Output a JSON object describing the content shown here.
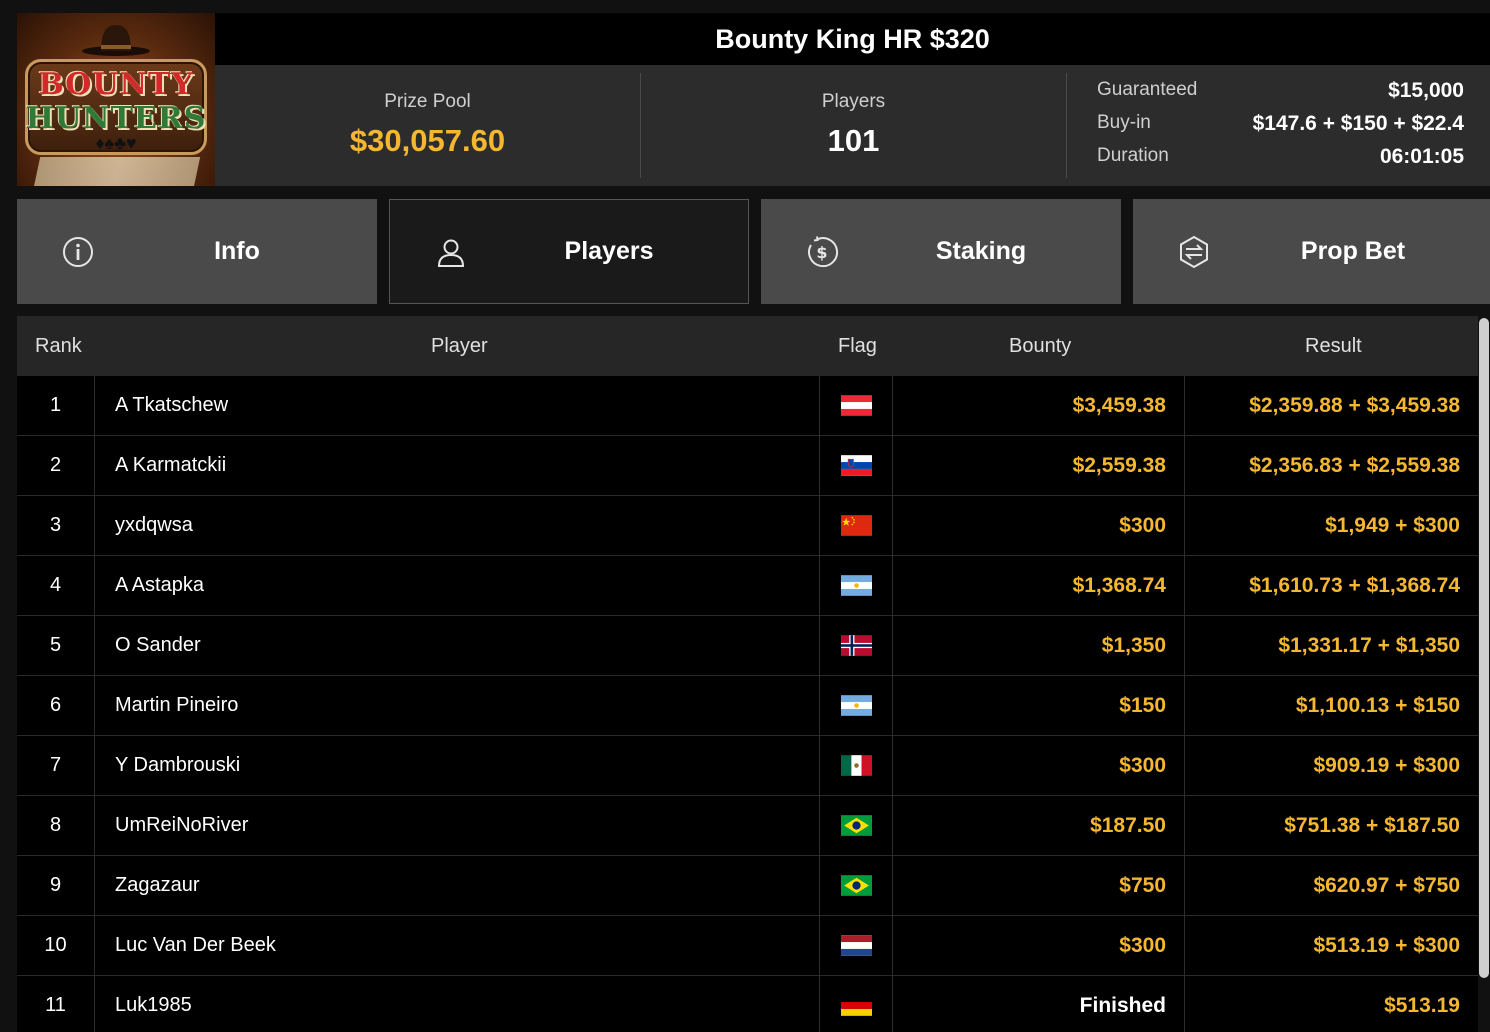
{
  "logo": {
    "line1": "BOUNTY",
    "line2": "HUNTERS",
    "suits": "♦♠♣♥"
  },
  "tournament": {
    "title": "Bounty King HR $320",
    "prize_pool_label": "Prize Pool",
    "prize_pool": "$30,057.60",
    "players_label": "Players",
    "players": "101",
    "details": [
      {
        "label": "Guaranteed",
        "value": "$15,000"
      },
      {
        "label": "Buy-in",
        "value": "$147.6 + $150 + $22.4"
      },
      {
        "label": "Duration",
        "value": "06:01:05"
      }
    ]
  },
  "tabs": [
    {
      "label": "Info",
      "icon": "info-icon"
    },
    {
      "label": "Players",
      "icon": "user-icon",
      "active": true
    },
    {
      "label": "Staking",
      "icon": "dollar-circle-icon"
    },
    {
      "label": "Prop Bet",
      "icon": "prop-bet-icon"
    }
  ],
  "table": {
    "headers": {
      "rank": "Rank",
      "player": "Player",
      "flag": "Flag",
      "bounty": "Bounty",
      "result": "Result"
    },
    "rows": [
      {
        "rank": "1",
        "player": "A Tkatschew",
        "flag": "austria",
        "bounty": "$3,459.38",
        "result": "$2,359.88 + $3,459.38"
      },
      {
        "rank": "2",
        "player": "A Karmatckii",
        "flag": "slovenia",
        "bounty": "$2,559.38",
        "result": "$2,356.83 + $2,559.38"
      },
      {
        "rank": "3",
        "player": "yxdqwsa",
        "flag": "china",
        "bounty": "$300",
        "result": "$1,949 + $300"
      },
      {
        "rank": "4",
        "player": "A Astapka",
        "flag": "argentina",
        "bounty": "$1,368.74",
        "result": "$1,610.73 + $1,368.74"
      },
      {
        "rank": "5",
        "player": "O Sander",
        "flag": "norway",
        "bounty": "$1,350",
        "result": "$1,331.17 + $1,350"
      },
      {
        "rank": "6",
        "player": "Martin Pineiro",
        "flag": "argentina",
        "bounty": "$150",
        "result": "$1,100.13 + $150"
      },
      {
        "rank": "7",
        "player": "Y Dambrouski",
        "flag": "mexico",
        "bounty": "$300",
        "result": "$909.19 + $300"
      },
      {
        "rank": "8",
        "player": "UmReiNoRiver",
        "flag": "brazil",
        "bounty": "$187.50",
        "result": "$751.38 + $187.50"
      },
      {
        "rank": "9",
        "player": "Zagazaur",
        "flag": "brazil",
        "bounty": "$750",
        "result": "$620.97 + $750"
      },
      {
        "rank": "10",
        "player": "Luc Van Der Beek",
        "flag": "netherlands",
        "bounty": "$300",
        "result": "$513.19 + $300"
      },
      {
        "rank": "11",
        "player": "Luk1985",
        "flag": "germany",
        "bounty": "Finished",
        "result": "$513.19"
      }
    ]
  },
  "colors": {
    "accent": "#f5b730",
    "tab_bg": "#4a4a4a",
    "tab_active_bg": "#1a1a1a",
    "row_bg": "#000000"
  }
}
